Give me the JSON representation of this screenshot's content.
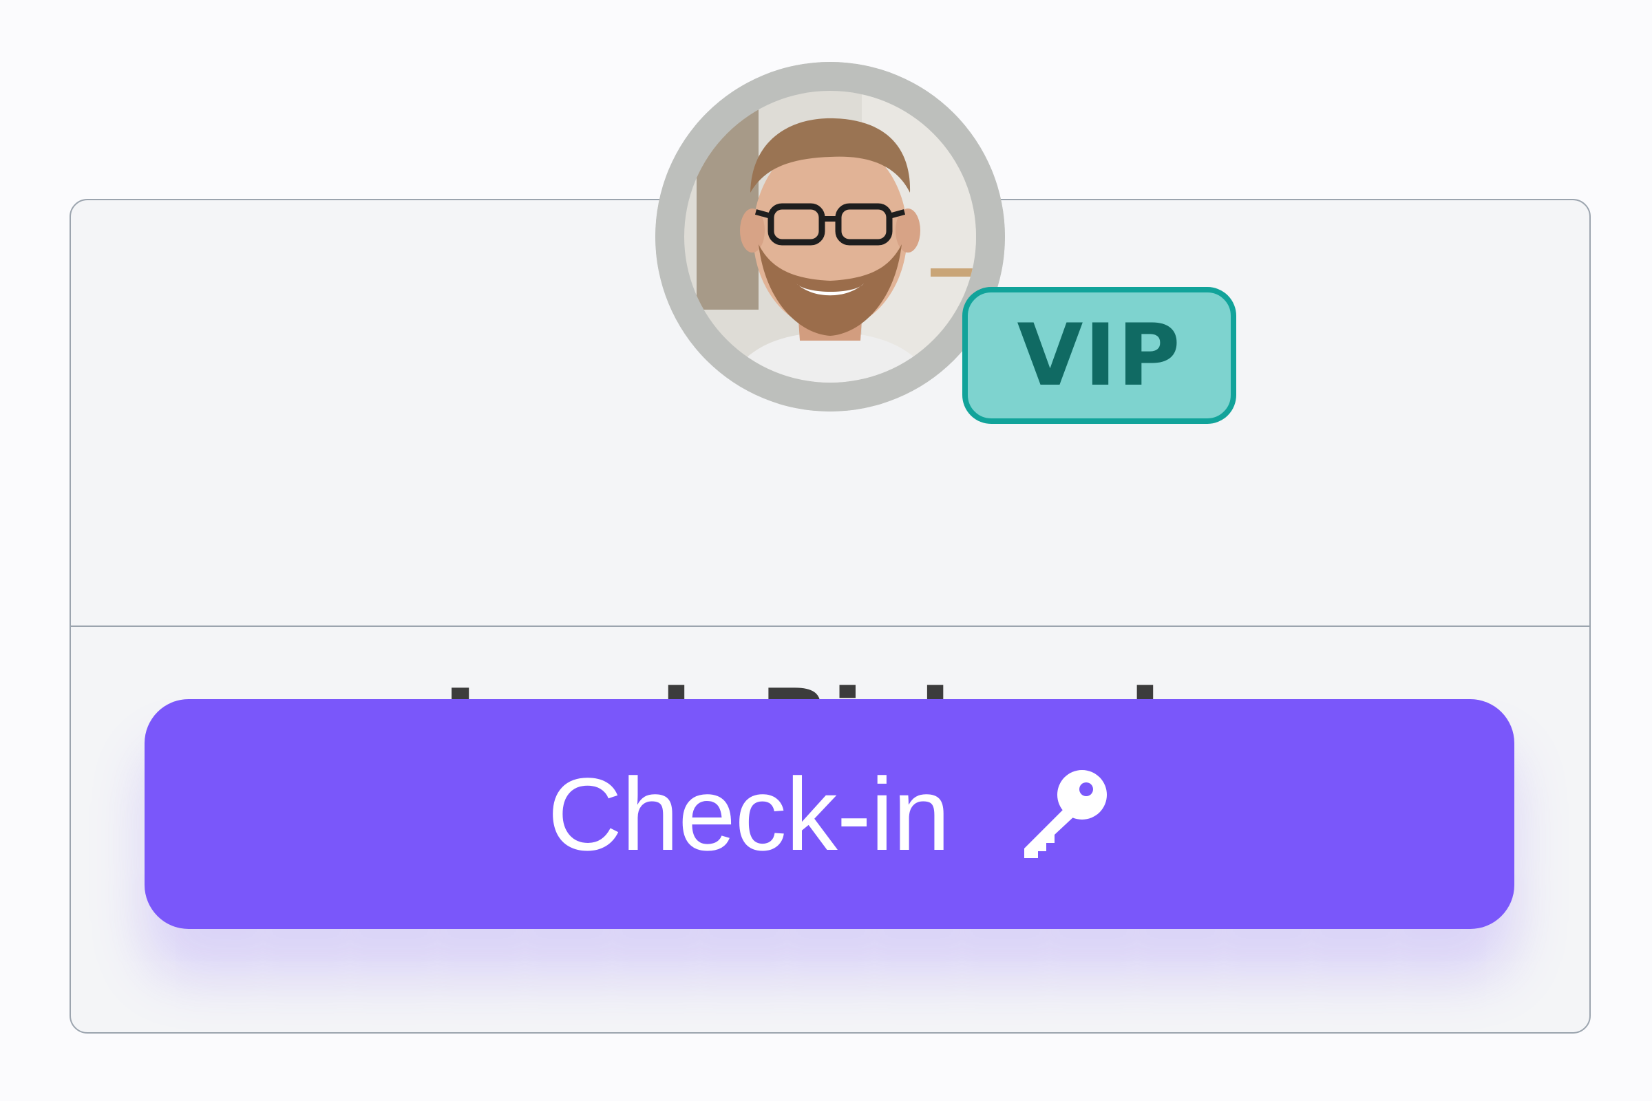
{
  "guest": {
    "name": "Jacob Richards",
    "badge": "VIP",
    "avatar_icon": "guest-portrait"
  },
  "action": {
    "label": "Check-in",
    "icon": "key-icon"
  },
  "colors": {
    "accent": "#7a57fa",
    "badge_bg": "#7ed3cf",
    "badge_border": "#11a39a",
    "badge_text": "#106a63",
    "name_text": "#3c3c3c"
  }
}
